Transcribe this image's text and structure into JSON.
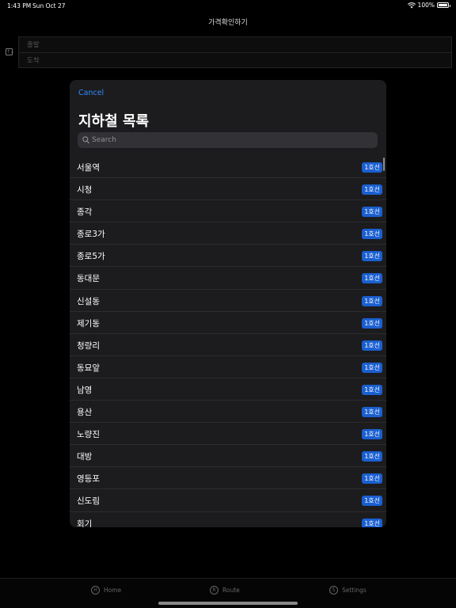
{
  "status_bar": {
    "time": "1:43 PM",
    "date": "Sun Oct 27",
    "battery": "100%"
  },
  "background": {
    "title": "가격확인하기",
    "departure_placeholder": "출발",
    "arrival_placeholder": "도착",
    "swap_label": "↑↓"
  },
  "modal": {
    "cancel_label": "Cancel",
    "title": "지하철 목록",
    "search_placeholder": "Search",
    "stations": [
      {
        "name": "서울역",
        "line": "1호선"
      },
      {
        "name": "시청",
        "line": "1호선"
      },
      {
        "name": "종각",
        "line": "1호선"
      },
      {
        "name": "종로3가",
        "line": "1호선"
      },
      {
        "name": "종로5가",
        "line": "1호선"
      },
      {
        "name": "동대문",
        "line": "1호선"
      },
      {
        "name": "신설동",
        "line": "1호선"
      },
      {
        "name": "제기동",
        "line": "1호선"
      },
      {
        "name": "청량리",
        "line": "1호선"
      },
      {
        "name": "동묘앞",
        "line": "1호선"
      },
      {
        "name": "남영",
        "line": "1호선"
      },
      {
        "name": "용산",
        "line": "1호선"
      },
      {
        "name": "노량진",
        "line": "1호선"
      },
      {
        "name": "대방",
        "line": "1호선"
      },
      {
        "name": "영등포",
        "line": "1호선"
      },
      {
        "name": "신도림",
        "line": "1호선"
      },
      {
        "name": "회기",
        "line": "1호선"
      }
    ]
  },
  "tab_bar": {
    "items": [
      {
        "label": "Home",
        "icon_letter": "H"
      },
      {
        "label": "Route",
        "icon_letter": "R"
      },
      {
        "label": "Settings",
        "icon_letter": "S"
      }
    ]
  },
  "colors": {
    "accent": "#2f8cff",
    "badge": "#1a5fd0",
    "modal_bg": "#1c1c1e"
  }
}
